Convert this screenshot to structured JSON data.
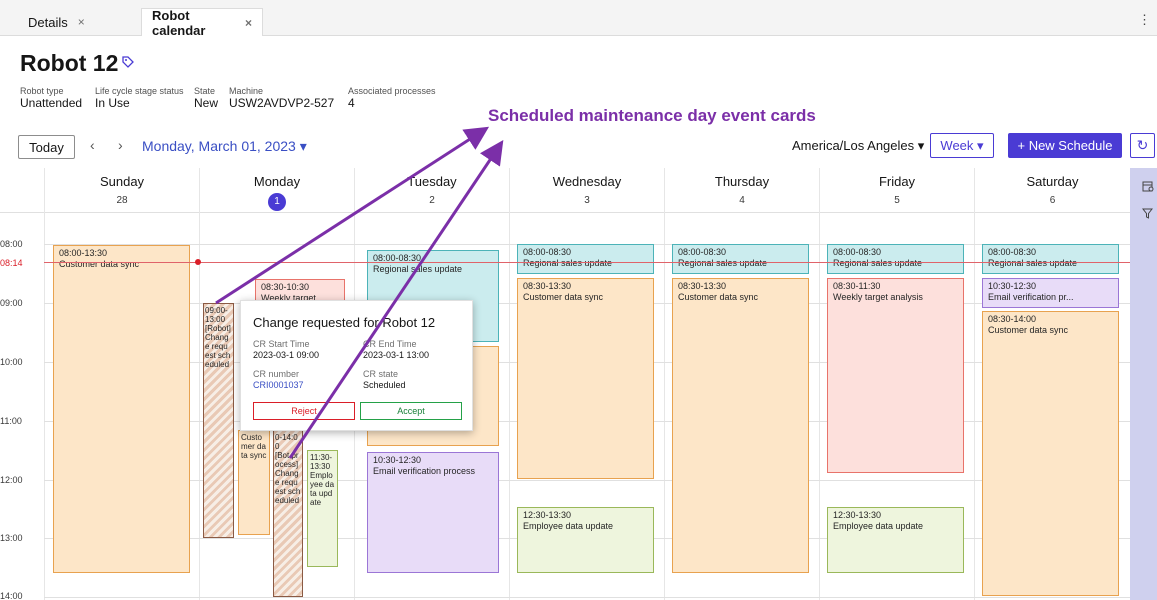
{
  "tabs": [
    {
      "label": "Details",
      "close": "×"
    },
    {
      "label": "Robot calendar",
      "close": "×"
    }
  ],
  "kebab": "⋮",
  "robot": {
    "title": "Robot 12",
    "tag_icon": "tag-icon"
  },
  "meta": [
    {
      "label": "Robot type",
      "value": "Unattended"
    },
    {
      "label": "Life cycle stage status",
      "value": "In Use"
    },
    {
      "label": "State",
      "value": "New"
    },
    {
      "label": "Machine",
      "value": "USW2AVDVP2-527"
    },
    {
      "label": "Associated processes",
      "value": "4"
    }
  ],
  "annotation": "Scheduled maintenance day event cards",
  "toolbar": {
    "today": "Today",
    "prev": "‹",
    "next": "›",
    "date": "Monday, March 01, 2023 ▾",
    "timezone": "America/Los Angeles ▾",
    "view": "Week ▾",
    "new_schedule": "+ New Schedule",
    "refresh": "↻"
  },
  "days": [
    {
      "name": "Sunday",
      "date": "28"
    },
    {
      "name": "Monday",
      "date": "1"
    },
    {
      "name": "Tuesday",
      "date": "2"
    },
    {
      "name": "Wednesday",
      "date": "3"
    },
    {
      "name": "Thursday",
      "date": "4"
    },
    {
      "name": "Friday",
      "date": "5"
    },
    {
      "name": "Saturday",
      "date": "6"
    }
  ],
  "hours": [
    "08:00",
    "09:00",
    "10:00",
    "11:00",
    "12:00",
    "13:00",
    "14:00"
  ],
  "now": "08:14",
  "events": {
    "sun_cds": {
      "time": "08:00-13:30",
      "name": "Customer data sync"
    },
    "mon_wta": {
      "time": "08:30-10:30",
      "name": "Weekly target"
    },
    "mon_cr1": {
      "time": "09:00-13:00",
      "name": "[Robot] Change request scheduled"
    },
    "mon_cds": {
      "time": "",
      "name": "Customer data sync"
    },
    "mon_cr2": {
      "time": "0-14:00",
      "name": "[Bot process] Change request scheduled"
    },
    "mon_edu": {
      "time": "11:30-13:30",
      "name": "Employee data update"
    },
    "tue_rsu": {
      "time": "08:00-08:30",
      "name": "Regional sales update"
    },
    "tue_evp": {
      "time": "10:30-12:30",
      "name": "Email verification process"
    },
    "wed_rsu": {
      "time": "08:00-08:30",
      "name": "Regional sales update"
    },
    "wed_cds": {
      "time": "08:30-13:30",
      "name": "Customer data sync"
    },
    "wed_edu": {
      "time": "12:30-13:30",
      "name": "Employee data update"
    },
    "thu_rsu": {
      "time": "08:00-08:30",
      "name": "Regional sales update"
    },
    "thu_cds": {
      "time": "08:30-13:30",
      "name": "Customer data sync"
    },
    "fri_rsu": {
      "time": "08:00-08:30",
      "name": "Regional sales update"
    },
    "fri_wta": {
      "time": "08:30-11:30",
      "name": "Weekly target analysis"
    },
    "fri_edu": {
      "time": "12:30-13:30",
      "name": "Employee data update"
    },
    "sat_rsu": {
      "time": "08:00-08:30",
      "name": "Regional sales update"
    },
    "sat_evp": {
      "time": "10:30-12:30",
      "name": "Email verification pr..."
    },
    "sat_cds": {
      "time": "08:30-14:00",
      "name": "Customer data sync"
    }
  },
  "popover": {
    "title": "Change requested for Robot 12",
    "start_label": "CR Start Time",
    "start_value": "2023-03-1 09:00",
    "end_label": "CR End Time",
    "end_value": "2023-03-1 13:00",
    "number_label": "CR number",
    "number_value": "CRI0001037",
    "state_label": "CR state",
    "state_value": "Scheduled",
    "reject": "Reject",
    "accept": "Accept"
  },
  "rail_icons": [
    "calendar-settings-icon",
    "filter-icon"
  ],
  "colors": {
    "accent": "#4a3bd4",
    "annotation": "#7b2fa8",
    "now": "#da1e28"
  }
}
